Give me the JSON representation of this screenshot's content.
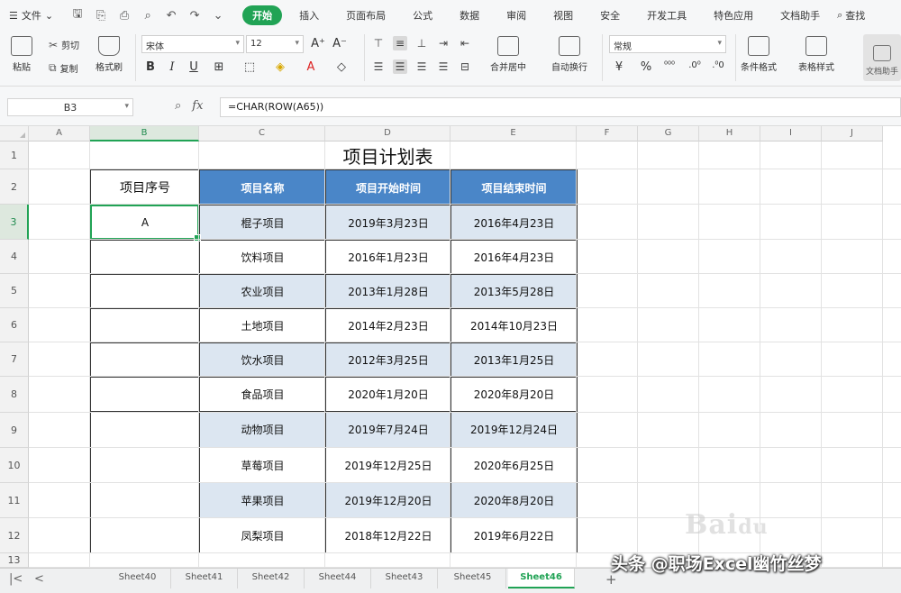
{
  "menubar": {
    "file_label": "文件",
    "tabs": [
      {
        "label": "开始",
        "active": true
      },
      {
        "label": "插入",
        "active": false
      },
      {
        "label": "页面布局",
        "active": false
      },
      {
        "label": "公式",
        "active": false
      },
      {
        "label": "数据",
        "active": false
      },
      {
        "label": "审阅",
        "active": false
      },
      {
        "label": "视图",
        "active": false
      },
      {
        "label": "安全",
        "active": false
      },
      {
        "label": "开发工具",
        "active": false
      },
      {
        "label": "特色应用",
        "active": false
      },
      {
        "label": "文档助手",
        "active": false
      }
    ],
    "search_label": "查找"
  },
  "ribbon": {
    "paste": "粘贴",
    "cut": "剪切",
    "copy": "复制",
    "format_painter": "格式刷",
    "font_name": "宋体",
    "font_size": "12",
    "merge_center": "合并居中",
    "wrap_text": "自动换行",
    "number_format": "常规",
    "conditional_format": "条件格式",
    "table_style": "表格样式",
    "doc_helper": "文档助手"
  },
  "formula_bar": {
    "cell_ref": "B3",
    "formula": "=CHAR(ROW(A65))"
  },
  "grid": {
    "columns": [
      "A",
      "B",
      "C",
      "D",
      "E",
      "F",
      "G",
      "H",
      "I",
      "J"
    ],
    "rows": [
      "1",
      "2",
      "3",
      "4",
      "5",
      "6",
      "7",
      "8",
      "9",
      "10",
      "11",
      "12",
      "13"
    ],
    "title": "项目计划表",
    "headers": [
      "项目序号",
      "项目名称",
      "项目开始时间",
      "项目结束时间"
    ],
    "records": [
      {
        "seq": "A",
        "name": "棍子项目",
        "start": "2019年3月23日",
        "end": "2016年4月23日"
      },
      {
        "seq": "",
        "name": "饮料项目",
        "start": "2016年1月23日",
        "end": "2016年4月23日"
      },
      {
        "seq": "",
        "name": "农业项目",
        "start": "2013年1月28日",
        "end": "2013年5月28日"
      },
      {
        "seq": "",
        "name": "土地项目",
        "start": "2014年2月23日",
        "end": "2014年10月23日"
      },
      {
        "seq": "",
        "name": "饮水项目",
        "start": "2012年3月25日",
        "end": "2013年1月25日"
      },
      {
        "seq": "",
        "name": "食品项目",
        "start": "2020年1月20日",
        "end": "2020年8月20日"
      },
      {
        "seq": "",
        "name": "动物项目",
        "start": "2019年7月24日",
        "end": "2019年12月24日"
      },
      {
        "seq": "",
        "name": "草莓项目",
        "start": "2019年12月25日",
        "end": "2020年6月25日"
      },
      {
        "seq": "",
        "name": "苹果项目",
        "start": "2019年12月20日",
        "end": "2020年8月20日"
      },
      {
        "seq": "",
        "name": "凤梨项目",
        "start": "2018年12月22日",
        "end": "2019年6月22日"
      }
    ]
  },
  "sheets": [
    {
      "label": "Sheet40",
      "active": false
    },
    {
      "label": "Sheet41",
      "active": false
    },
    {
      "label": "Sheet42",
      "active": false
    },
    {
      "label": "Sheet44",
      "active": false
    },
    {
      "label": "Sheet43",
      "active": false
    },
    {
      "label": "Sheet45",
      "active": false
    },
    {
      "label": "Sheet46",
      "active": true
    }
  ],
  "watermark": "头条 @职场Excel幽竹丝梦",
  "colors": {
    "accent": "#21a355",
    "header_blue": "#4a86c8",
    "stripe": "#dce6f1"
  }
}
